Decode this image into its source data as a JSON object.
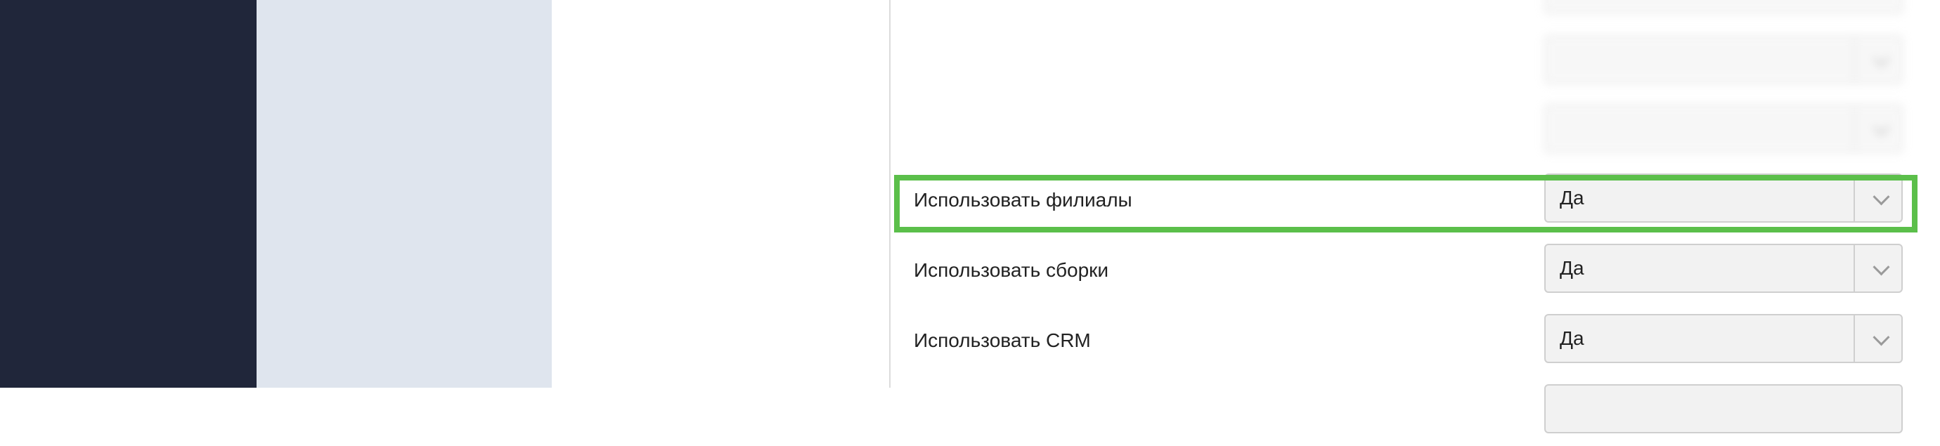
{
  "settings": {
    "rows": [
      {
        "label": "Использовать филиалы",
        "value": "Да"
      },
      {
        "label": "Использовать сборки",
        "value": "Да"
      },
      {
        "label": "Использовать CRM",
        "value": "Да"
      }
    ]
  },
  "colors": {
    "dark_sidebar": "#20263a",
    "light_sidebar": "#dfe5ee",
    "highlight": "#5bbf4a"
  }
}
